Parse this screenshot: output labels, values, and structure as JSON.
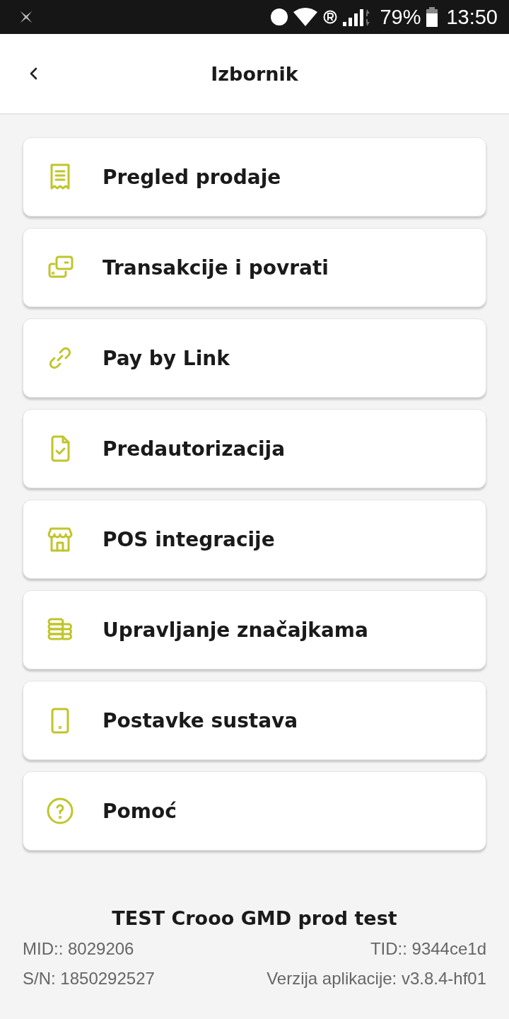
{
  "status_bar": {
    "battery": "79%",
    "time": "13:50"
  },
  "header": {
    "title": "Izbornik"
  },
  "menu": [
    {
      "label": "Pregled prodaje"
    },
    {
      "label": "Transakcije i povrati"
    },
    {
      "label": "Pay by Link"
    },
    {
      "label": "Predautorizacija"
    },
    {
      "label": "POS integracije"
    },
    {
      "label": "Upravljanje značajkama"
    },
    {
      "label": "Postavke sustava"
    },
    {
      "label": "Pomoć"
    }
  ],
  "footer": {
    "merchant": "TEST Crooo GMD prod test",
    "mid": "MID:: 8029206",
    "tid": "TID:: 9344ce1d",
    "serial": "S/N: 1850292527",
    "version": "Verzija aplikacije: v3.8.4-hf01"
  }
}
